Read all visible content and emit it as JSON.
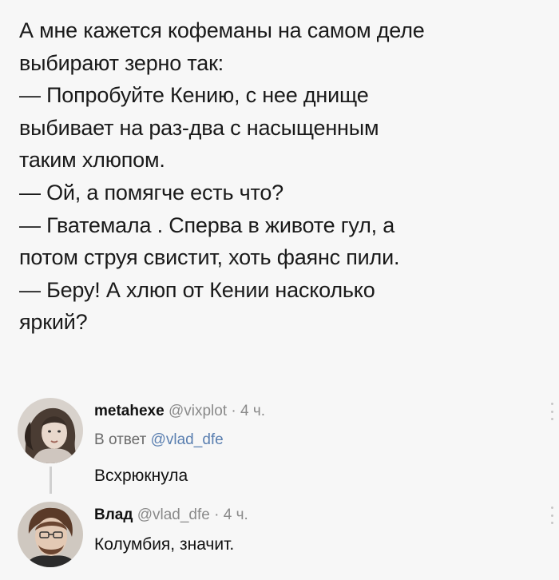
{
  "post": {
    "lines": [
      "А мне кажется кофеманы на самом деле",
      "выбирают зерно так:",
      "— Попробуйте Кению, с нее днище",
      "выбивает на раз-два с насыщенным",
      "таким хлюпом.",
      "— Ой, а помягче есть что?",
      "— Гватемала . Сперва в животе гул, а",
      "потом струя свистит, хоть фаянс пили.",
      "— Беру! А хлюп от Кении насколько",
      "яркий?"
    ]
  },
  "replies": [
    {
      "name": "metahexe",
      "handle": "@vixplot",
      "separator": "·",
      "time": "4 ч.",
      "reply_prefix": "В ответ",
      "reply_mention": "@vlad_dfe",
      "text": "Всхрюкнула",
      "avatar_icon": "woman-portrait-avatar"
    },
    {
      "name": "Влад",
      "handle": "@vlad_dfe",
      "separator": "·",
      "time": "4 ч.",
      "text": "Колумбия, значит.",
      "avatar_icon": "man-portrait-avatar"
    }
  ],
  "icons": {
    "more": "vertical-dots-icon"
  },
  "colors": {
    "background": "#f7f7f7",
    "text": "#1a1a1a",
    "secondary": "#8a8a8a",
    "mention": "#5a7fb0"
  }
}
